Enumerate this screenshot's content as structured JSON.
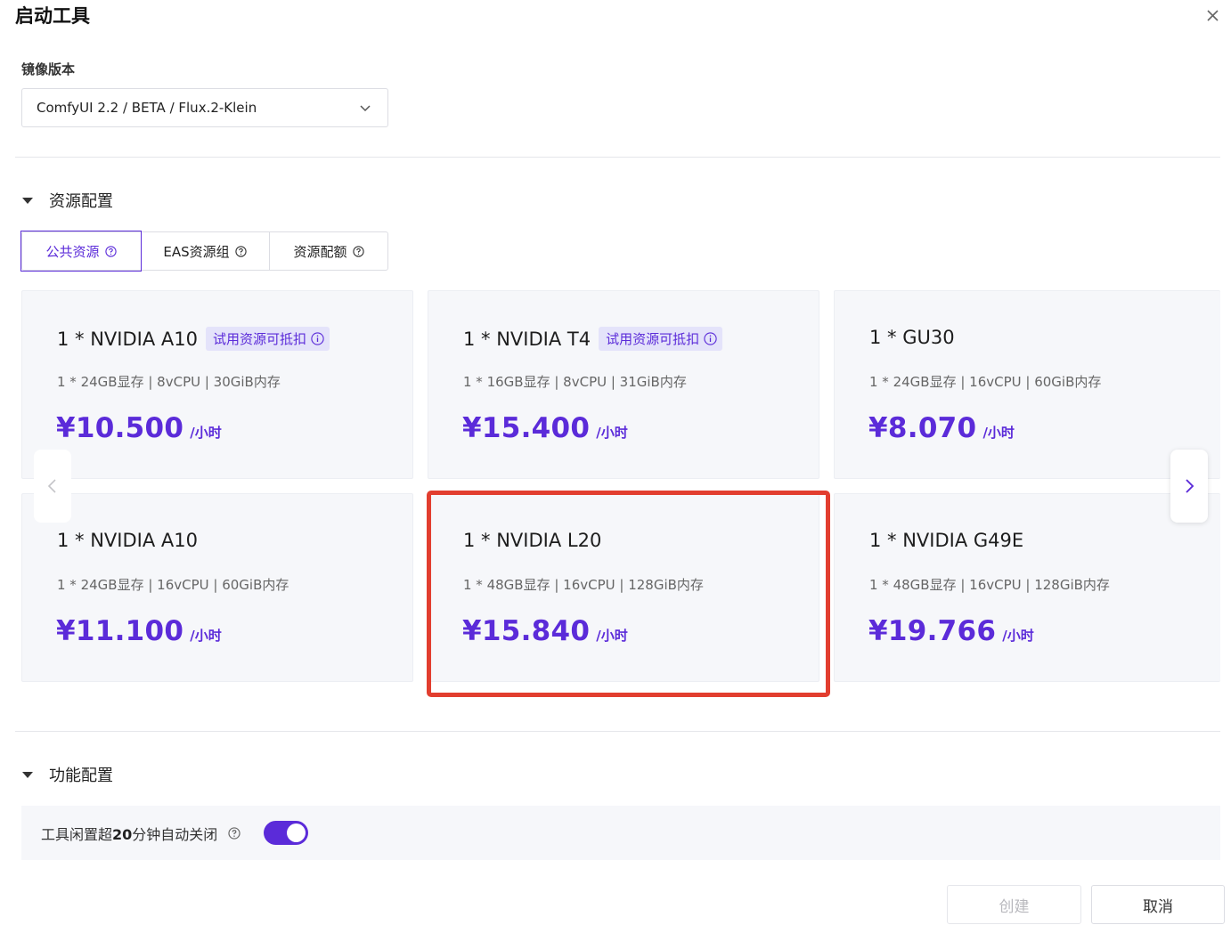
{
  "dialog": {
    "title": "启动工具",
    "close_icon": "close-icon"
  },
  "image_version": {
    "label": "镜像版本",
    "selected": "ComfyUI 2.2 / BETA / Flux.2-Klein"
  },
  "resource_section": {
    "title": "资源配置",
    "tabs": [
      {
        "label": "公共资源",
        "active": true
      },
      {
        "label": "EAS资源组",
        "active": false
      },
      {
        "label": "资源配额",
        "active": false
      }
    ],
    "cards": [
      {
        "name": "1 * NVIDIA A10",
        "tag": "试用资源可抵扣",
        "spec": "1 * 24GB显存 | 8vCPU | 30GiB内存",
        "price": "¥10.500",
        "unit": "/小时"
      },
      {
        "name": "1 * NVIDIA T4",
        "tag": "试用资源可抵扣",
        "spec": "1 * 16GB显存 | 8vCPU | 31GiB内存",
        "price": "¥15.400",
        "unit": "/小时"
      },
      {
        "name": "1 * GU30",
        "tag": "",
        "spec": "1 * 24GB显存 | 16vCPU | 60GiB内存",
        "price": "¥8.070",
        "unit": "/小时"
      },
      {
        "name": "1 * NVIDIA A10",
        "tag": "",
        "spec": "1 * 24GB显存 | 16vCPU | 60GiB内存",
        "price": "¥11.100",
        "unit": "/小时"
      },
      {
        "name": "1 * NVIDIA L20",
        "tag": "",
        "spec": "1 * 48GB显存 | 16vCPU | 128GiB内存",
        "price": "¥15.840",
        "unit": "/小时",
        "highlighted": true
      },
      {
        "name": "1 * NVIDIA G49E",
        "tag": "",
        "spec": "1 * 48GB显存 | 16vCPU | 128GiB内存",
        "price": "¥19.766",
        "unit": "/小时"
      }
    ]
  },
  "feature_section": {
    "title": "功能配置",
    "auto_close": {
      "prefix": "工具闲置超",
      "number": "20",
      "suffix": "分钟自动关闭",
      "enabled": true
    }
  },
  "footer": {
    "create_label": "创建",
    "cancel_label": "取消"
  },
  "colors": {
    "accent": "#5b2bd9",
    "highlight_border": "#e23e2f",
    "card_bg": "#f6f7fa"
  }
}
